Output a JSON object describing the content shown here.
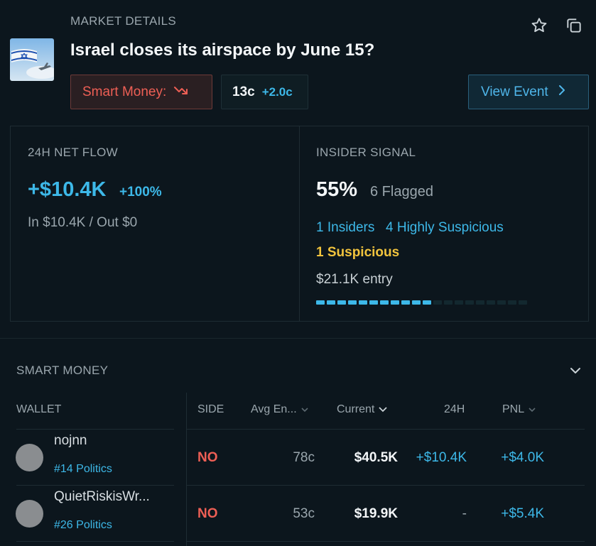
{
  "header": {
    "eyebrow": "MARKET DETAILS",
    "title": "Israel closes its airspace by June 15?",
    "icons": [
      "star-icon",
      "copy-icon"
    ]
  },
  "chips": {
    "smart_money_label": "Smart Money:",
    "smart_money_trend": "trending-down-icon",
    "price": "13c",
    "price_change": "+2.0c",
    "view_event_label": "View Event"
  },
  "net_flow": {
    "label": "24H NET FLOW",
    "value": "+$10.4K",
    "pct": "+100%",
    "sub": "In $10.4K / Out $0"
  },
  "insider": {
    "label": "INSIDER SIGNAL",
    "pct": "55%",
    "flagged": "6 Flagged",
    "insiders": "1 Insiders",
    "highly_suspicious": "4 Highly Suspicious",
    "suspicious": "1 Suspicious",
    "entry": "$21.1K entry",
    "bar_total_segments": 20,
    "bar_filled_fraction": 0.55
  },
  "smart_money": {
    "title": "SMART MONEY",
    "columns": {
      "wallet": "WALLET",
      "side": "SIDE",
      "avg": "Avg En...",
      "current": "Current",
      "h24": "24H",
      "pnl": "PNL"
    },
    "rows": [
      {
        "name": "nojnn",
        "rank": "#14 Politics",
        "side": "NO",
        "avg": "78c",
        "current": "$40.5K",
        "h24": "+$10.4K",
        "pnl": "+$4.0K"
      },
      {
        "name": "QuietRiskisWr...",
        "rank": "#26 Politics",
        "side": "NO",
        "avg": "53c",
        "current": "$19.9K",
        "h24": "-",
        "pnl": "+$5.4K"
      }
    ]
  },
  "colors": {
    "background": "#0c161d",
    "accent_blue": "#3db8e8",
    "negative_red": "#ee5f55",
    "warning_yellow": "#f2c43d"
  }
}
